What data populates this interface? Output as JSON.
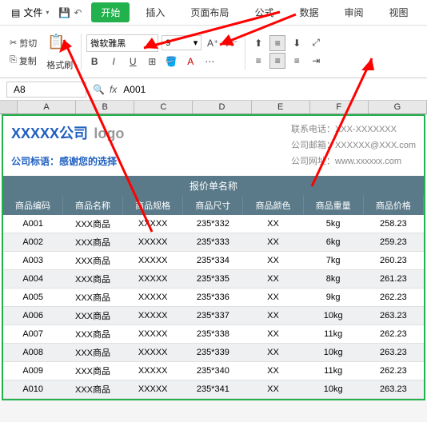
{
  "menubar": {
    "file": "文件"
  },
  "tabs": [
    "开始",
    "插入",
    "页面布局",
    "公式",
    "数据",
    "审阅",
    "视图"
  ],
  "ribbon": {
    "cut": "剪切",
    "copy": "复制",
    "paste": "格式刷",
    "font_name": "微软雅黑",
    "font_size": "9",
    "bold": "B",
    "italic": "I",
    "underline": "U"
  },
  "namebox": "A8",
  "fx_value": "A001",
  "col_headers": [
    "A",
    "B",
    "C",
    "D",
    "E",
    "F",
    "G"
  ],
  "company": "XXXXX公司",
  "logo": "logo",
  "slogan": "公司标语：感谢您的选择",
  "contact": {
    "phone_label": "联系电话：",
    "phone": "XXX-XXXXXXX",
    "email_label": "公司邮箱：",
    "email": "XXXXXX@XXX.com",
    "web_label": "公司网址：",
    "web": "www.xxxxxx.com"
  },
  "quote_title": "报价单名称",
  "table_headers": [
    "商品编码",
    "商品名称",
    "商品规格",
    "商品尺寸",
    "商品颜色",
    "商品重量",
    "商品价格"
  ],
  "chart_data": {
    "type": "table",
    "columns": [
      "商品编码",
      "商品名称",
      "商品规格",
      "商品尺寸",
      "商品颜色",
      "商品重量",
      "商品价格"
    ],
    "rows": [
      [
        "A001",
        "XXX商品",
        "XXXXX",
        "235*332",
        "XX",
        "5kg",
        "258.23"
      ],
      [
        "A002",
        "XXX商品",
        "XXXXX",
        "235*333",
        "XX",
        "6kg",
        "259.23"
      ],
      [
        "A003",
        "XXX商品",
        "XXXXX",
        "235*334",
        "XX",
        "7kg",
        "260.23"
      ],
      [
        "A004",
        "XXX商品",
        "XXXXX",
        "235*335",
        "XX",
        "8kg",
        "261.23"
      ],
      [
        "A005",
        "XXX商品",
        "XXXXX",
        "235*336",
        "XX",
        "9kg",
        "262.23"
      ],
      [
        "A006",
        "XXX商品",
        "XXXXX",
        "235*337",
        "XX",
        "10kg",
        "263.23"
      ],
      [
        "A007",
        "XXX商品",
        "XXXXX",
        "235*338",
        "XX",
        "11kg",
        "262.23"
      ],
      [
        "A008",
        "XXX商品",
        "XXXXX",
        "235*339",
        "XX",
        "10kg",
        "263.23"
      ],
      [
        "A009",
        "XXX商品",
        "XXXXX",
        "235*340",
        "XX",
        "11kg",
        "262.23"
      ],
      [
        "A010",
        "XXX商品",
        "XXXXX",
        "235*341",
        "XX",
        "10kg",
        "263.23"
      ]
    ]
  }
}
